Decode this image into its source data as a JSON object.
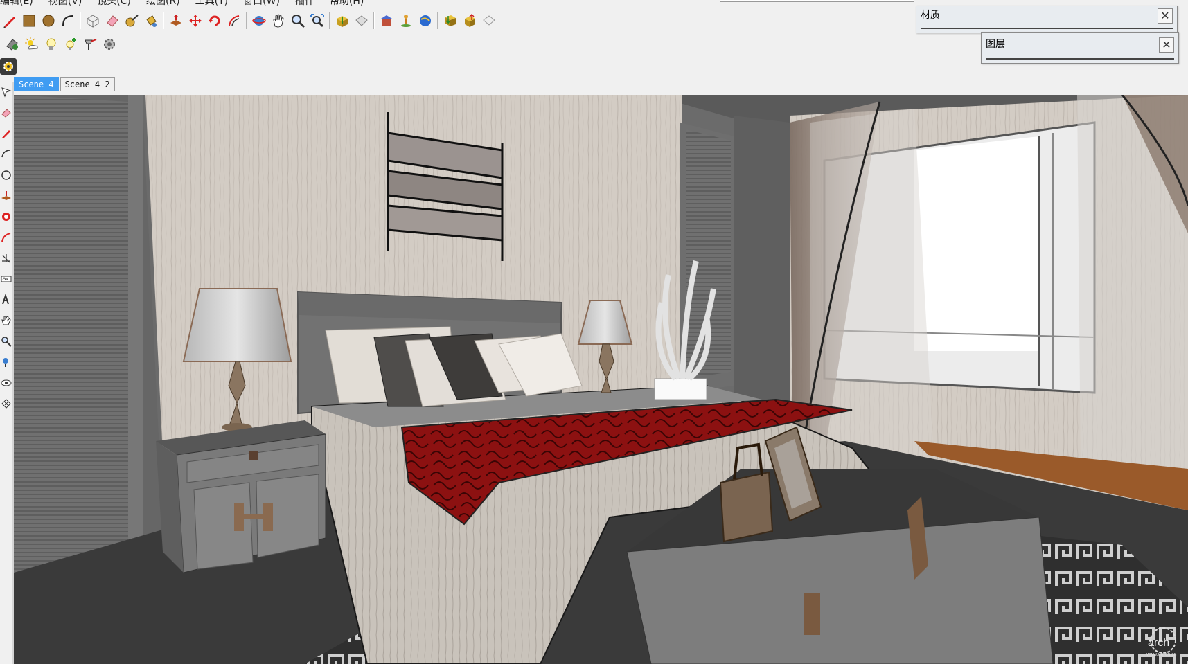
{
  "menu": {
    "items": [
      "编辑(E)",
      "视图(V)",
      "镜头(C)",
      "绘图(R)",
      "工具(T)",
      "窗口(W)",
      "插件",
      "帮助(H)"
    ]
  },
  "toolbar_row1": [
    "pencil-icon",
    "rectangle-icon",
    "circle-icon",
    "arc-icon",
    "make-component-icon",
    "eraser-icon",
    "tape-measure-icon",
    "paint-bucket-icon",
    "push-pull-icon",
    "move-icon",
    "rotate-icon",
    "offset-icon",
    "orbit-icon",
    "pan-icon",
    "zoom-icon",
    "zoom-extents-icon",
    "get-models-icon",
    "share-model-icon",
    "3d-warehouse-icon",
    "add-location-icon",
    "google-earth-icon",
    "get-components-icon",
    "share-component-icon",
    "extension-icon"
  ],
  "toolbar_row2": [
    "shadow-icon",
    "sun-icon",
    "bulb-icon",
    "add-light-icon",
    "spotlight-icon",
    "render-settings-icon"
  ],
  "panels": {
    "materials_title": "材质",
    "layers_title": "图层"
  },
  "scene_tabs": {
    "active": "Scene 4",
    "other": "Scene 4_2"
  },
  "watermark": {
    "text": "arch",
    "subtext": "www.uarch.cn"
  },
  "colors": {
    "active_tab": "#3f9cf2",
    "bed_runner": "#8c1111",
    "wall": "#d3ccc4"
  }
}
